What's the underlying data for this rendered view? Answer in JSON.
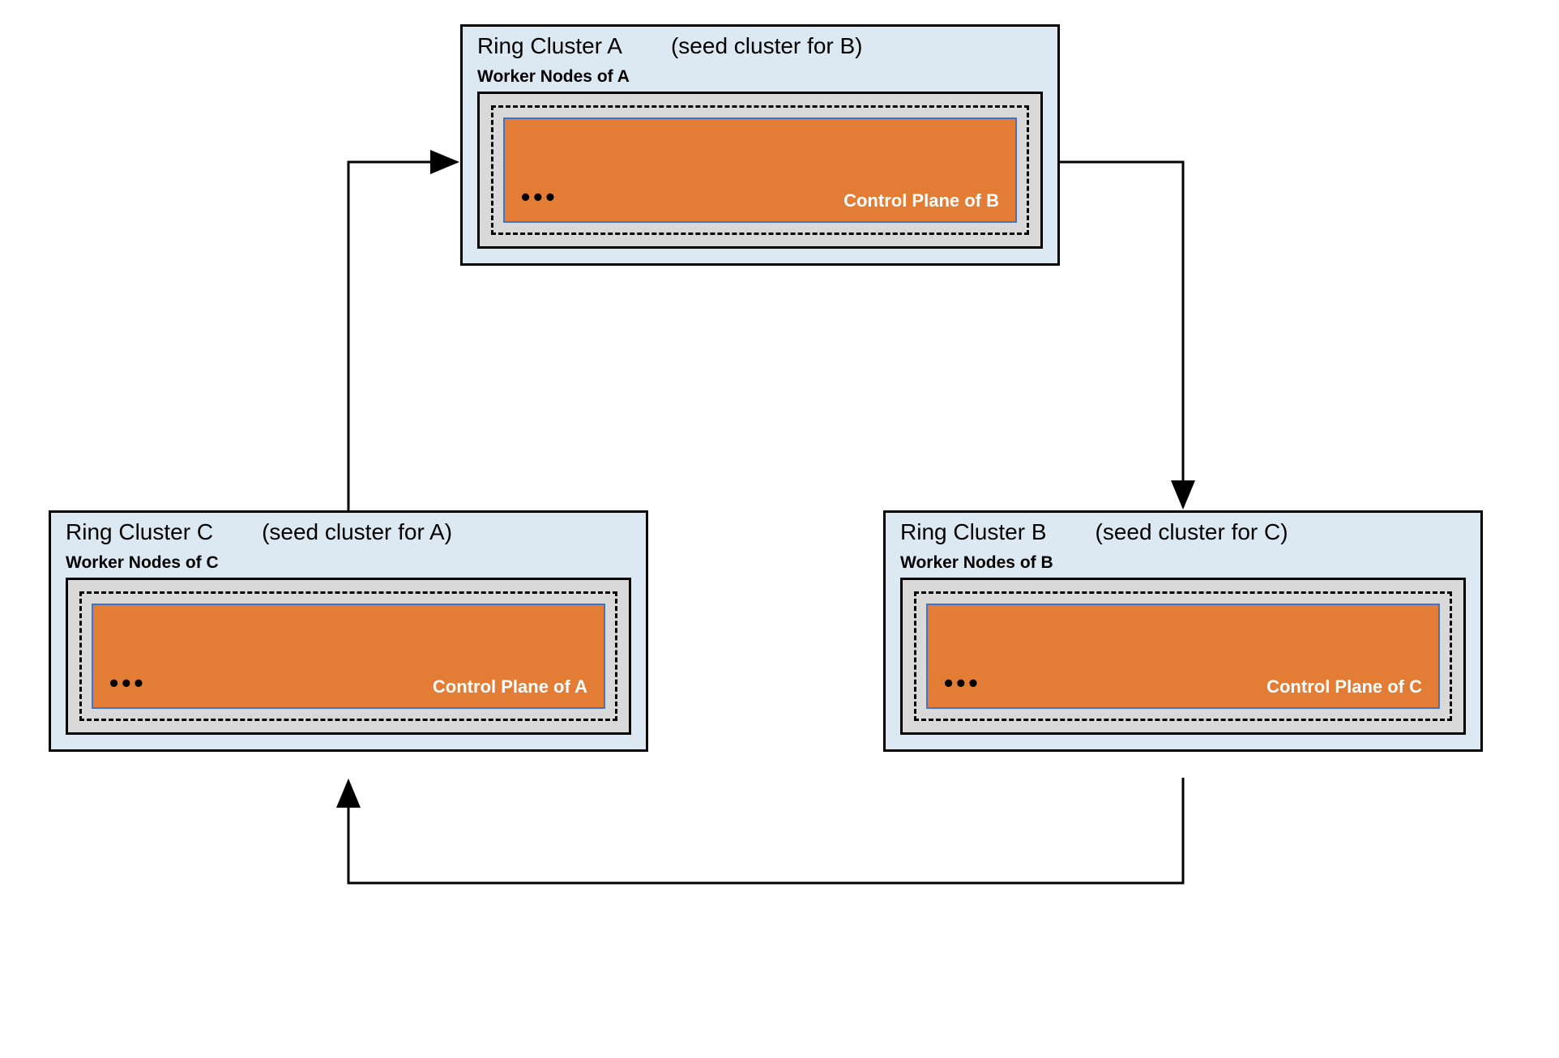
{
  "clusters": {
    "a": {
      "title": "Ring Cluster A",
      "seed": "(seed cluster for B)",
      "worker_label": "Worker Nodes of A",
      "dots": "•••",
      "control_label": "Control Plane of B"
    },
    "b": {
      "title": "Ring Cluster B",
      "seed": "(seed cluster for C)",
      "worker_label": "Worker Nodes of B",
      "dots": "•••",
      "control_label": "Control Plane of C"
    },
    "c": {
      "title": "Ring Cluster C",
      "seed": "(seed cluster for A)",
      "worker_label": "Worker Nodes of C",
      "dots": "•••",
      "control_label": "Control Plane of A"
    }
  },
  "arrows": [
    {
      "from": "A",
      "to": "B"
    },
    {
      "from": "B",
      "to": "C"
    },
    {
      "from": "C",
      "to": "A"
    }
  ]
}
